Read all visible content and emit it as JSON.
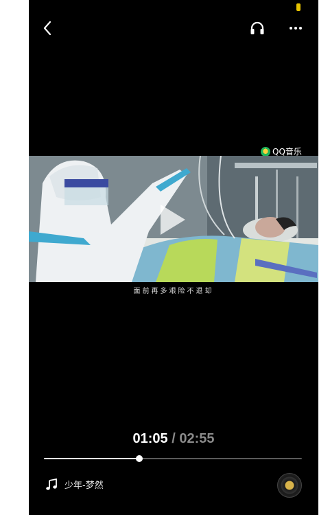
{
  "top_bar": {
    "back_icon": "chevron-left-icon",
    "listen_icon": "headphones-icon",
    "more_icon": "more-horizontal-icon"
  },
  "video": {
    "watermark": "QQ音乐",
    "subtitle": "面前再多艰险不退却",
    "play_icon": "play-icon"
  },
  "player": {
    "current_time": "01:05",
    "separator": " / ",
    "duration": "02:55",
    "progress_fraction": 0.37
  },
  "song": {
    "icon": "music-note-icon",
    "title": "少年-梦然"
  },
  "colors": {
    "background": "#000000",
    "accent": "#ffffff",
    "muted": "#8a8a8a"
  }
}
